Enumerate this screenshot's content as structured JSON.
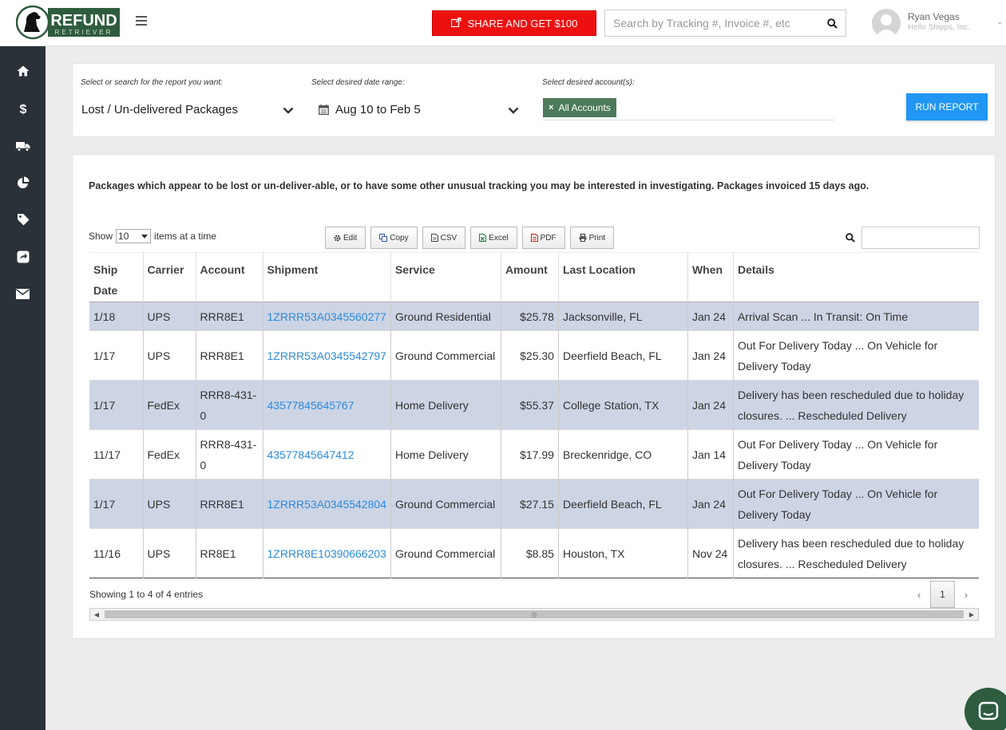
{
  "brand": {
    "name": "REFUND",
    "sub": "RETRIEVER"
  },
  "header": {
    "share_label": "SHARE AND GET $100",
    "search_placeholder": "Search by Tracking #, Invoice #, etc",
    "user_name": "Ryan Vegas",
    "user_org": "Hello Shipps, Inc."
  },
  "sidebar": {
    "items": [
      {
        "name": "home",
        "icon": "home-icon"
      },
      {
        "name": "refunds",
        "icon": "dollar-icon"
      },
      {
        "name": "shipments",
        "icon": "truck-icon"
      },
      {
        "name": "reports",
        "icon": "pie-chart-icon"
      },
      {
        "name": "tags",
        "icon": "tag-icon"
      },
      {
        "name": "share",
        "icon": "share-icon"
      },
      {
        "name": "messages",
        "icon": "envelope-icon"
      }
    ]
  },
  "filters": {
    "report_label": "Select or search for the report you want:",
    "report_value": "Lost / Un-delivered Packages",
    "date_label": "Select desired date range:",
    "date_value": "Aug 10 to Feb 5",
    "account_label": "Select desired account(s):",
    "account_tag": "All Accounts",
    "run_label": "RUN REPORT"
  },
  "report": {
    "description": "Packages which appear to be lost or un-deliver-able, or to have some other unusual tracking you may be interested in investigating. Packages invoiced 15 days ago.",
    "show_label": "Show",
    "page_length": "10",
    "items_label": "items at a time",
    "buttons": [
      "Edit",
      "Copy",
      "CSV",
      "Excel",
      "PDF",
      "Print"
    ],
    "columns": [
      "Ship Date",
      "Carrier",
      "Account",
      "Shipment",
      "Service",
      "Amount",
      "Last Location",
      "When",
      "Details"
    ],
    "rows": [
      {
        "ship_date": "1/18",
        "carrier": "UPS",
        "account": "RRR8E1",
        "shipment": "1ZRRR53A0345560277",
        "service": "Ground Residential",
        "amount": "$25.78",
        "location": "Jacksonville, FL",
        "when": "Jan 24",
        "details": "Arrival Scan ... In Transit: On Time"
      },
      {
        "ship_date": "1/17",
        "carrier": "UPS",
        "account": "RRR8E1",
        "shipment": "1ZRRR53A0345542797",
        "service": "Ground Commercial",
        "amount": "$25.30",
        "location": "Deerfield Beach, FL",
        "when": "Jan 24",
        "details": "Out For Delivery Today ... On Vehicle for Delivery Today"
      },
      {
        "ship_date": "1/17",
        "carrier": "FedEx",
        "account": "RRR8-431-0",
        "shipment": "43577845645767",
        "service": "Home Delivery",
        "amount": "$55.37",
        "location": "College Station, TX",
        "when": "Jan 24",
        "details": "Delivery has been rescheduled due to holiday closures. ... Rescheduled Delivery"
      },
      {
        "ship_date": "11/17",
        "carrier": "FedEx",
        "account": "RRR8-431-0",
        "shipment": "43577845647412",
        "service": "Home Delivery",
        "amount": "$17.99",
        "location": "Breckenridge, CO",
        "when": "Jan 14",
        "details": "Out For Delivery Today ... On Vehicle for Delivery Today"
      },
      {
        "ship_date": "1/17",
        "carrier": "UPS",
        "account": "RRR8E1",
        "shipment": "1ZRRR53A0345542804",
        "service": "Ground Commercial",
        "amount": "$27.15",
        "location": "Deerfield Beach, FL",
        "when": "Jan 24",
        "details": "Out For Delivery Today ... On Vehicle for Delivery Today"
      },
      {
        "ship_date": "11/16",
        "carrier": "UPS",
        "account": "RR8E1",
        "shipment": "1ZRRR8E10390666203",
        "service": "Ground Commercial",
        "amount": "$8.85",
        "location": "Houston, TX",
        "when": "Nov 24",
        "details": "Delivery has been rescheduled due to holiday closures. ... Rescheduled Delivery"
      }
    ],
    "info": "Showing 1 to 4 of 4 entries",
    "current_page": "1"
  },
  "colors": {
    "share": "#ee1010",
    "run": "#2196f3",
    "tag": "#4c7a5a",
    "shade": "#cdd4e4",
    "link": "#2a8bdd",
    "sidebar": "#2a3139",
    "chat": "#2e5c3e"
  }
}
